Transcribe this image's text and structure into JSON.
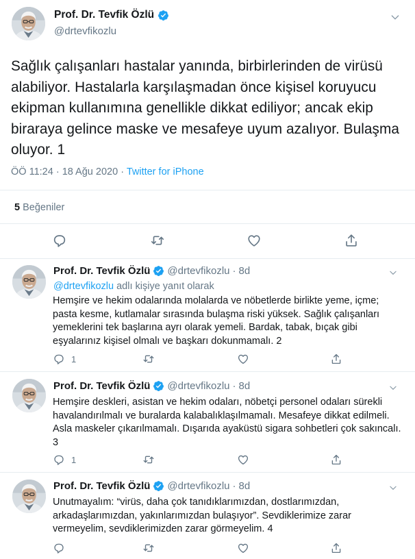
{
  "main_tweet": {
    "author_name": "Prof. Dr. Tevfik Özlü",
    "author_handle": "@drtevfikozlu",
    "text": "Sağlık çalışanları hastalar yanında,  birbirlerinden de virüsü alabiliyor. Hastalarla karşılaşmadan önce kişisel koruyucu ekipman kullanımına genellikle dikkat ediliyor; ancak ekip biraraya gelince maske ve mesafeye uyum azalıyor. Bulaşma oluyor. 1",
    "time": "ÖÖ 11:24",
    "separator": "·",
    "date": "18 Ağu 2020",
    "source": "Twitter for iPhone",
    "likes_count": "5",
    "likes_label": "Beğeniler"
  },
  "replies": [
    {
      "author_name": "Prof. Dr. Tevfik Özlü",
      "author_handle": "@drtevfikozlu",
      "dot": "·",
      "time": "8d",
      "replying_mention": "@drtevfikozlu",
      "replying_suffix": "adlı kişiye yanıt olarak",
      "text": "Hemşire ve hekim odalarında molalarda ve nöbetlerde birlikte yeme, içme; pasta kesme, kutlamalar sırasında bulaşma riski yüksek. Sağlık çalışanları yemeklerini tek başlarına ayrı olarak yemeli. Bardak, tabak, bıçak gibi eşyalarınız kişisel olmalı ve başkarı dokunmamalı. 2",
      "reply_count": "1",
      "retweet_count": "",
      "like_count": ""
    },
    {
      "author_name": "Prof. Dr. Tevfik Özlü",
      "author_handle": "@drtevfikozlu",
      "dot": "·",
      "time": "8d",
      "text": "Hemşire deskleri, asistan ve hekim odaları, nöbetçi personel odaları sürekli havalandırılmalı ve buralarda kalabalıklaşılmamalı. Mesafeye dikkat edilmeli. Asla maskeler çıkarılmamalı. Dışarıda ayaküstü sigara sohbetleri çok sakıncalı. 3",
      "reply_count": "1",
      "retweet_count": "",
      "like_count": ""
    },
    {
      "author_name": "Prof. Dr. Tevfik Özlü",
      "author_handle": "@drtevfikozlu",
      "dot": "·",
      "time": "8d",
      "text": "Unutmayalım: “virüs, daha çok tanıdıklarımızdan, dostlarımızdan, arkadaşlarımızdan, yakınlarımızdan bulaşıyor”. Sevdiklerimize zarar vermeyelim, sevdiklerimizden zarar görmeyelim. 4",
      "reply_count": "",
      "retweet_count": "",
      "like_count": ""
    }
  ],
  "icons": {
    "verified": "verified-badge-icon",
    "chevron": "chevron-down-icon",
    "reply": "reply-icon",
    "retweet": "retweet-icon",
    "like": "heart-icon",
    "share": "share-icon"
  },
  "colors": {
    "accent": "#1da1f2",
    "secondary_text": "#657786",
    "primary_text": "#14171a",
    "border": "#e6ecf0"
  }
}
